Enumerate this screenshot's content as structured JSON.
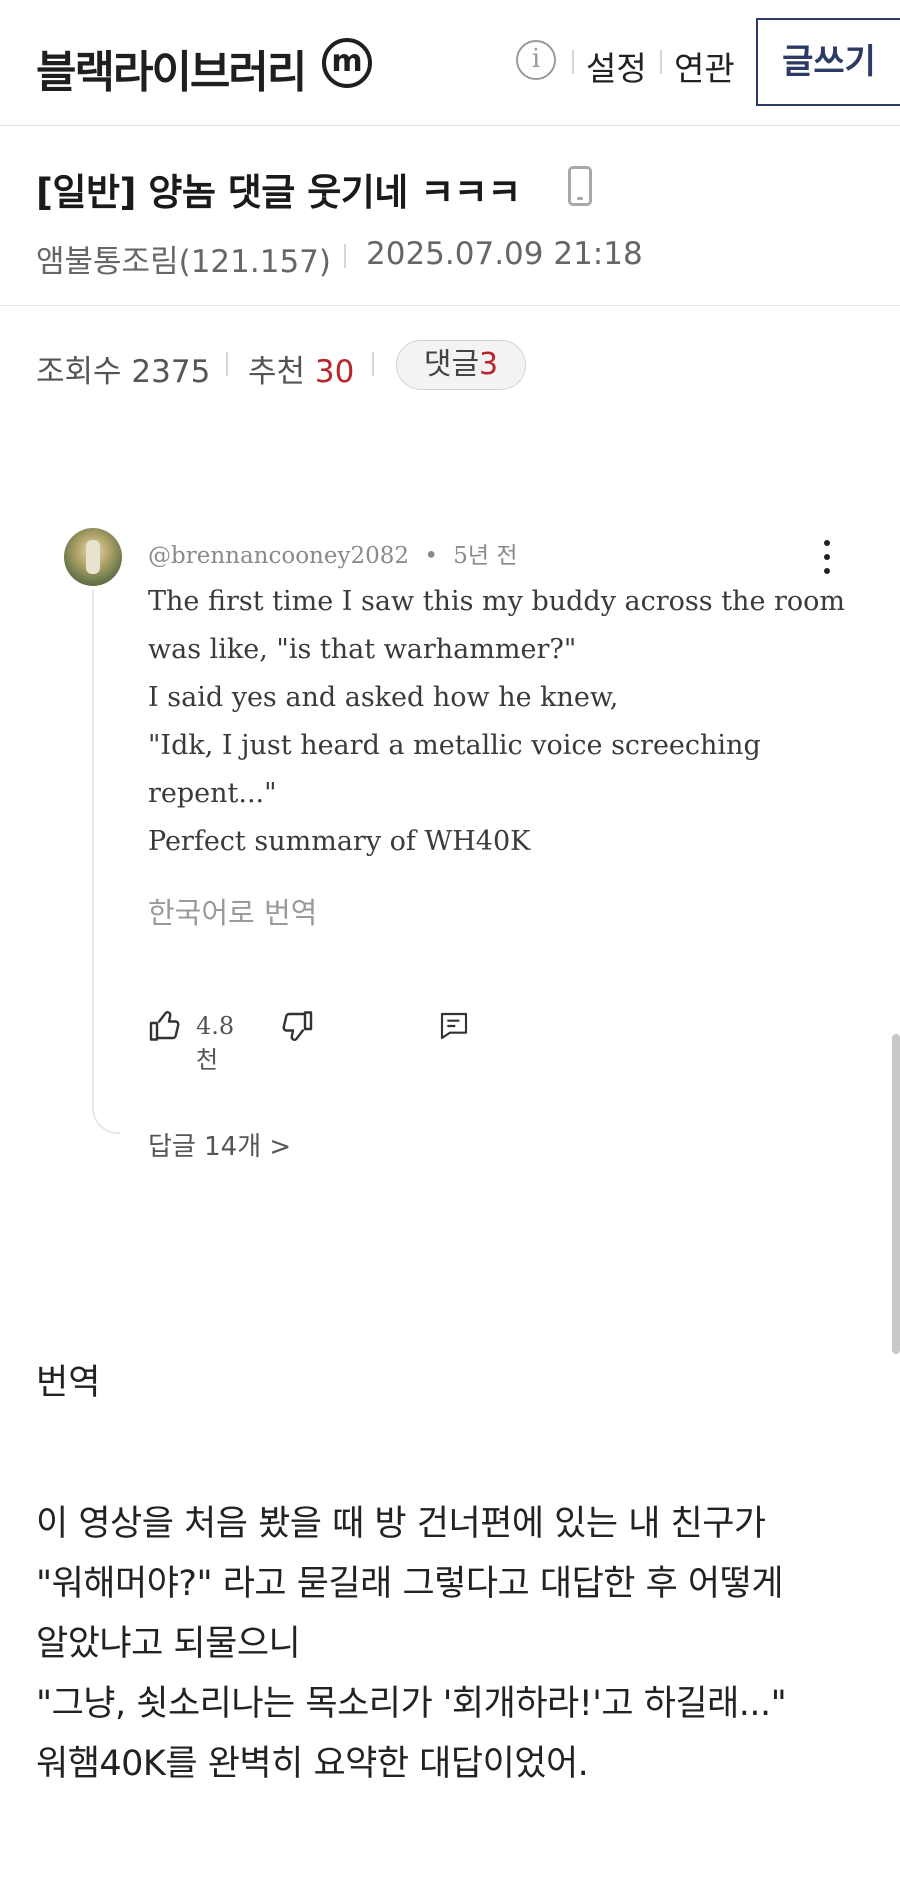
{
  "header": {
    "site_name": "블랙라이브러리",
    "logo_badge": "m",
    "info_icon": "info-icon",
    "settings_label": "설정",
    "related_label": "연관",
    "write_label": "글쓰기",
    "accent_color": "#2c3a66"
  },
  "post": {
    "title": "[일반] 양놈 댓글 웃기네 ㅋㅋㅋ",
    "device_icon": "mobile-phone-icon",
    "author": "앰불통조림(121.157)",
    "date": "2025.07.09 21:18"
  },
  "stats": {
    "views_label": "조회수",
    "views": "2375",
    "recommend_label": "추천",
    "recommend": "30",
    "comments_label": "댓글",
    "comments": "3",
    "highlight_color": "#b8262b"
  },
  "embedded_comment": {
    "username": "@brennancooney2082",
    "dot": "•",
    "time_ago": "5년 전",
    "lines": [
      "The first time I saw this my buddy across the room",
      "was like, \"is that warhammer?\"",
      "I said yes and asked how he knew,",
      "\"Idk, I just heard a metallic voice screeching",
      "repent...\"",
      "Perfect summary of WH40K"
    ],
    "translate_label": "한국어로 번역",
    "like_count": "4.8천",
    "replies_label": "답글 14개 >"
  },
  "translation": {
    "heading": "번역",
    "lines": [
      "이 영상을 처음 봤을 때 방 건너편에 있는 내 친구가",
      "\"워해머야?\" 라고 묻길래 그렇다고 대답한 후 어떻게",
      "알았냐고 되물으니",
      "\"그냥, 쇳소리나는 목소리가 '회개하라!'고 하길래...\"",
      "워햄40K를 완벽히 요약한 대답이었어."
    ]
  }
}
